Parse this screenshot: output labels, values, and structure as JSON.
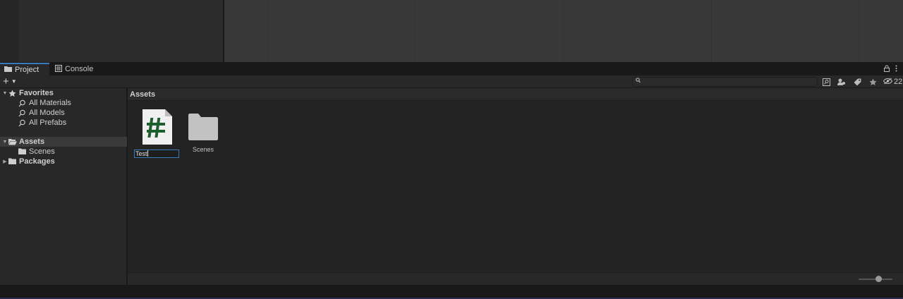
{
  "tabs": [
    {
      "label": "Project",
      "icon": "folder-icon",
      "active": true
    },
    {
      "label": "Console",
      "icon": "console-icon",
      "active": false
    }
  ],
  "toolbar": {
    "create_label": "+",
    "search_placeholder": "",
    "hidden_count": "22"
  },
  "tree": {
    "favorites": {
      "label": "Favorites",
      "items": [
        "All Materials",
        "All Models",
        "All Prefabs"
      ]
    },
    "assets": {
      "label": "Assets",
      "children": [
        "Scenes"
      ]
    },
    "packages": {
      "label": "Packages"
    }
  },
  "main": {
    "breadcrumb": "Assets",
    "items": [
      {
        "type": "csharp-script",
        "name": "Test",
        "renaming": true,
        "glyph": "#"
      },
      {
        "type": "folder",
        "name": "Scenes",
        "renaming": false
      }
    ]
  },
  "zoom_slider": {
    "value": 0.6
  },
  "colors": {
    "accent": "#3a79bb",
    "script_glyph": "#1d5e2f",
    "folder": "#c2c2c2"
  }
}
